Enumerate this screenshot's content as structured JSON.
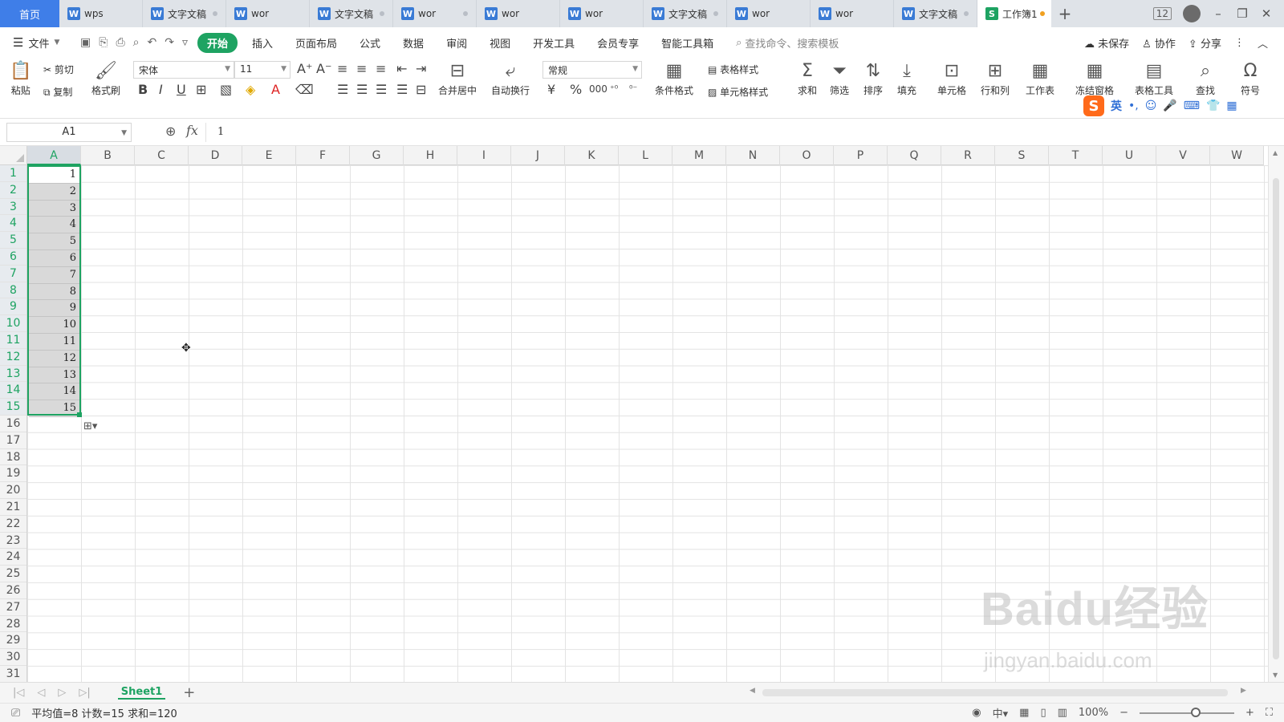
{
  "tabs": {
    "home": "首页",
    "docs": [
      {
        "label": "wps"
      },
      {
        "label": "文字文稿"
      },
      {
        "label": "wor"
      },
      {
        "label": "文字文稿"
      },
      {
        "label": "wor"
      },
      {
        "label": "wor"
      },
      {
        "label": "wor"
      },
      {
        "label": "文字文稿"
      },
      {
        "label": "wor"
      },
      {
        "label": "wor"
      },
      {
        "label": "文字文稿"
      }
    ],
    "active": "工作簿1",
    "doc_icon": "W",
    "sheet_icon": "S",
    "badge": "12"
  },
  "menu": {
    "file": "文件",
    "tabs": [
      "开始",
      "插入",
      "页面布局",
      "公式",
      "数据",
      "审阅",
      "视图",
      "开发工具",
      "会员专享",
      "智能工具箱"
    ],
    "search_placeholder": "查找命令、搜索模板",
    "unsaved": "未保存",
    "collab": "协作",
    "share": "分享"
  },
  "ribbon": {
    "paste": "粘贴",
    "cut": "剪切",
    "copy": "复制",
    "format_painter": "格式刷",
    "font_name": "宋体",
    "font_size": "11",
    "number_format": "常规",
    "merge_center": "合并居中",
    "wrap_text": "自动换行",
    "conditional_format": "条件格式",
    "table_style": "表格样式",
    "cell_style": "单元格样式",
    "sum": "求和",
    "filter": "筛选",
    "sort": "排序",
    "fill": "填充",
    "cell": "单元格",
    "row_col": "行和列",
    "worksheet": "工作表",
    "freeze": "冻结窗格",
    "table_tools": "表格工具",
    "find": "查找",
    "symbol": "符号",
    "ime_lang": "英"
  },
  "formula_bar": {
    "name_box": "A1",
    "fx": "fx",
    "value": "1"
  },
  "grid": {
    "columns": [
      "A",
      "B",
      "C",
      "D",
      "E",
      "F",
      "G",
      "H",
      "I",
      "J",
      "K",
      "L",
      "M",
      "N",
      "O",
      "P",
      "Q",
      "R",
      "S",
      "T",
      "U",
      "V",
      "W"
    ],
    "rows": [
      "1",
      "2",
      "3",
      "4",
      "5",
      "6",
      "7",
      "8",
      "9",
      "10",
      "11",
      "12",
      "13",
      "14",
      "15",
      "16",
      "17",
      "18",
      "19",
      "20",
      "21",
      "22",
      "23",
      "24",
      "25",
      "26",
      "27",
      "28",
      "29",
      "30",
      "31"
    ],
    "column_a_values": [
      "1",
      "2",
      "3",
      "4",
      "5",
      "6",
      "7",
      "8",
      "9",
      "10",
      "11",
      "12",
      "13",
      "14",
      "15"
    ]
  },
  "watermark": {
    "main": "Baidu经验",
    "sub": "jingyan.baidu.com"
  },
  "sheets": {
    "active": "Sheet1"
  },
  "status": {
    "summary": "平均值=8  计数=15  求和=120",
    "zoom": "100%"
  }
}
